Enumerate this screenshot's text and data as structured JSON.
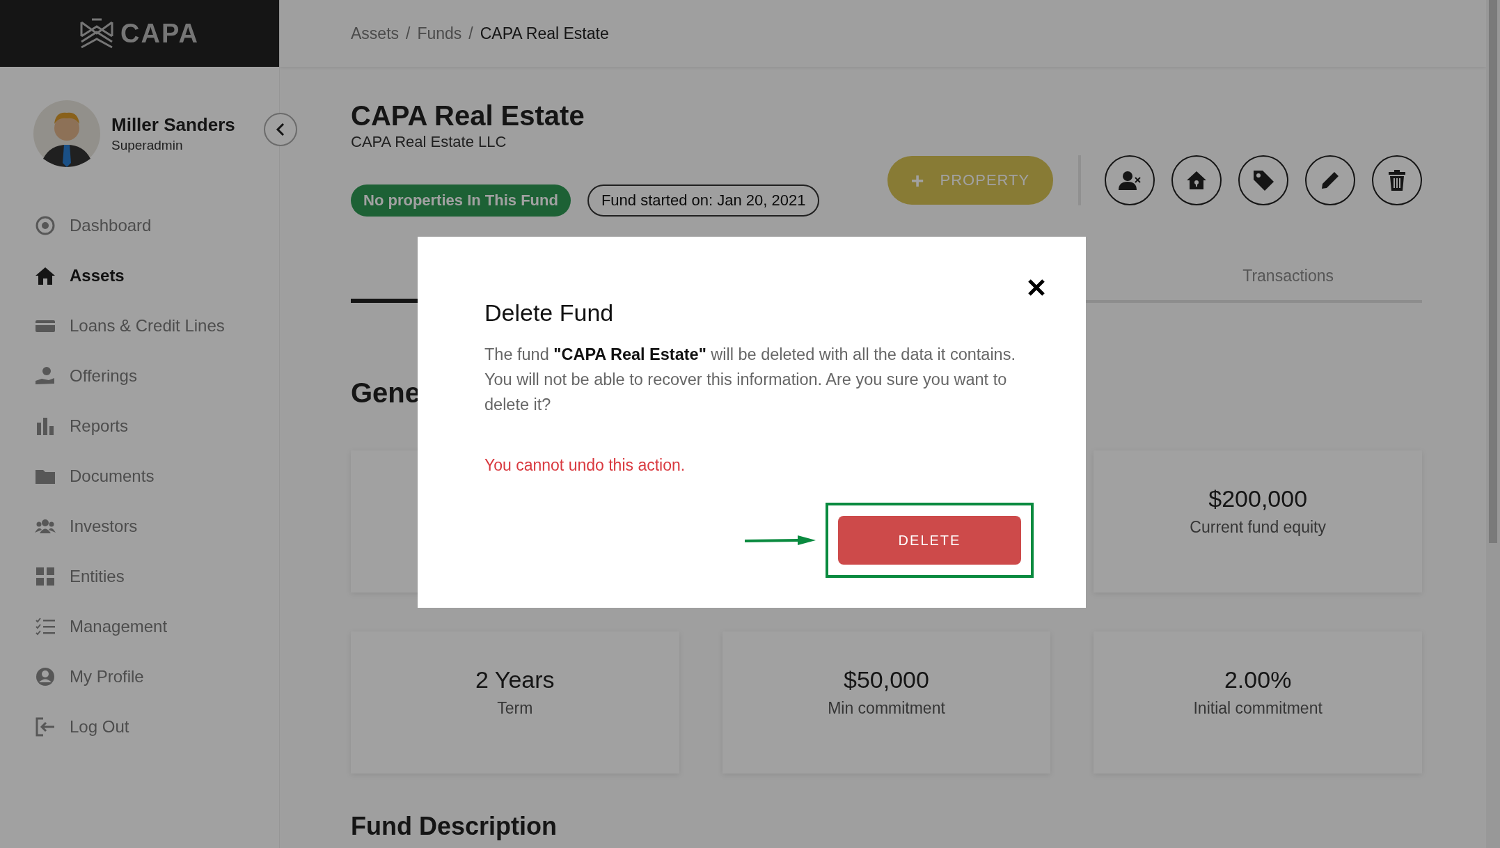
{
  "logo": {
    "text": "CAPA"
  },
  "user": {
    "name": "Miller Sanders",
    "role": "Superadmin"
  },
  "sidebar": {
    "items": [
      {
        "label": "Dashboard",
        "selected": false
      },
      {
        "label": "Assets",
        "selected": true
      },
      {
        "label": "Loans & Credit Lines",
        "selected": false
      },
      {
        "label": "Offerings",
        "selected": false
      },
      {
        "label": "Reports",
        "selected": false
      },
      {
        "label": "Documents",
        "selected": false
      },
      {
        "label": "Investors",
        "selected": false
      },
      {
        "label": "Entities",
        "selected": false
      },
      {
        "label": "Management",
        "selected": false
      },
      {
        "label": "My Profile",
        "selected": false
      },
      {
        "label": "Log Out",
        "selected": false
      }
    ]
  },
  "breadcrumb": [
    {
      "kind": "link",
      "text": "Assets"
    },
    {
      "kind": "separator",
      "text": "/"
    },
    {
      "kind": "link",
      "text": "Funds"
    },
    {
      "kind": "separator",
      "text": "/"
    },
    {
      "kind": "current",
      "text": "CAPA Real Estate"
    }
  ],
  "fund": {
    "title": "CAPA Real Estate",
    "subtitle": "CAPA Real Estate LLC",
    "status_pill": "No properties In This Fund",
    "start_pill": "Fund started on: Jan 20, 2021"
  },
  "actions": {
    "add_button": {
      "icon": "+",
      "label": "PROPERTY"
    }
  },
  "tabs": [
    {
      "selected": true
    },
    {
      "label": "Transactions",
      "selected": false
    }
  ],
  "section_title": "Gene",
  "summary_cards": [
    {
      "value": "$200,000",
      "label": "Current fund equity"
    }
  ],
  "stat_cards": [
    {
      "value": "2 Years",
      "label": "Term"
    },
    {
      "value": "$50,000",
      "label": "Min commitment"
    },
    {
      "value": "2.00%",
      "label": "Initial commitment"
    }
  ],
  "next_section_title": "Fund Description",
  "modal": {
    "title": "Delete Fund",
    "body": "The fund **\"CAPA Real Estate\"** will be deleted with all the data it contains. You will not be able to recover this information. Are you sure you want to delete it?",
    "warning": "You cannot undo this action.",
    "confirm": "DELETE"
  }
}
